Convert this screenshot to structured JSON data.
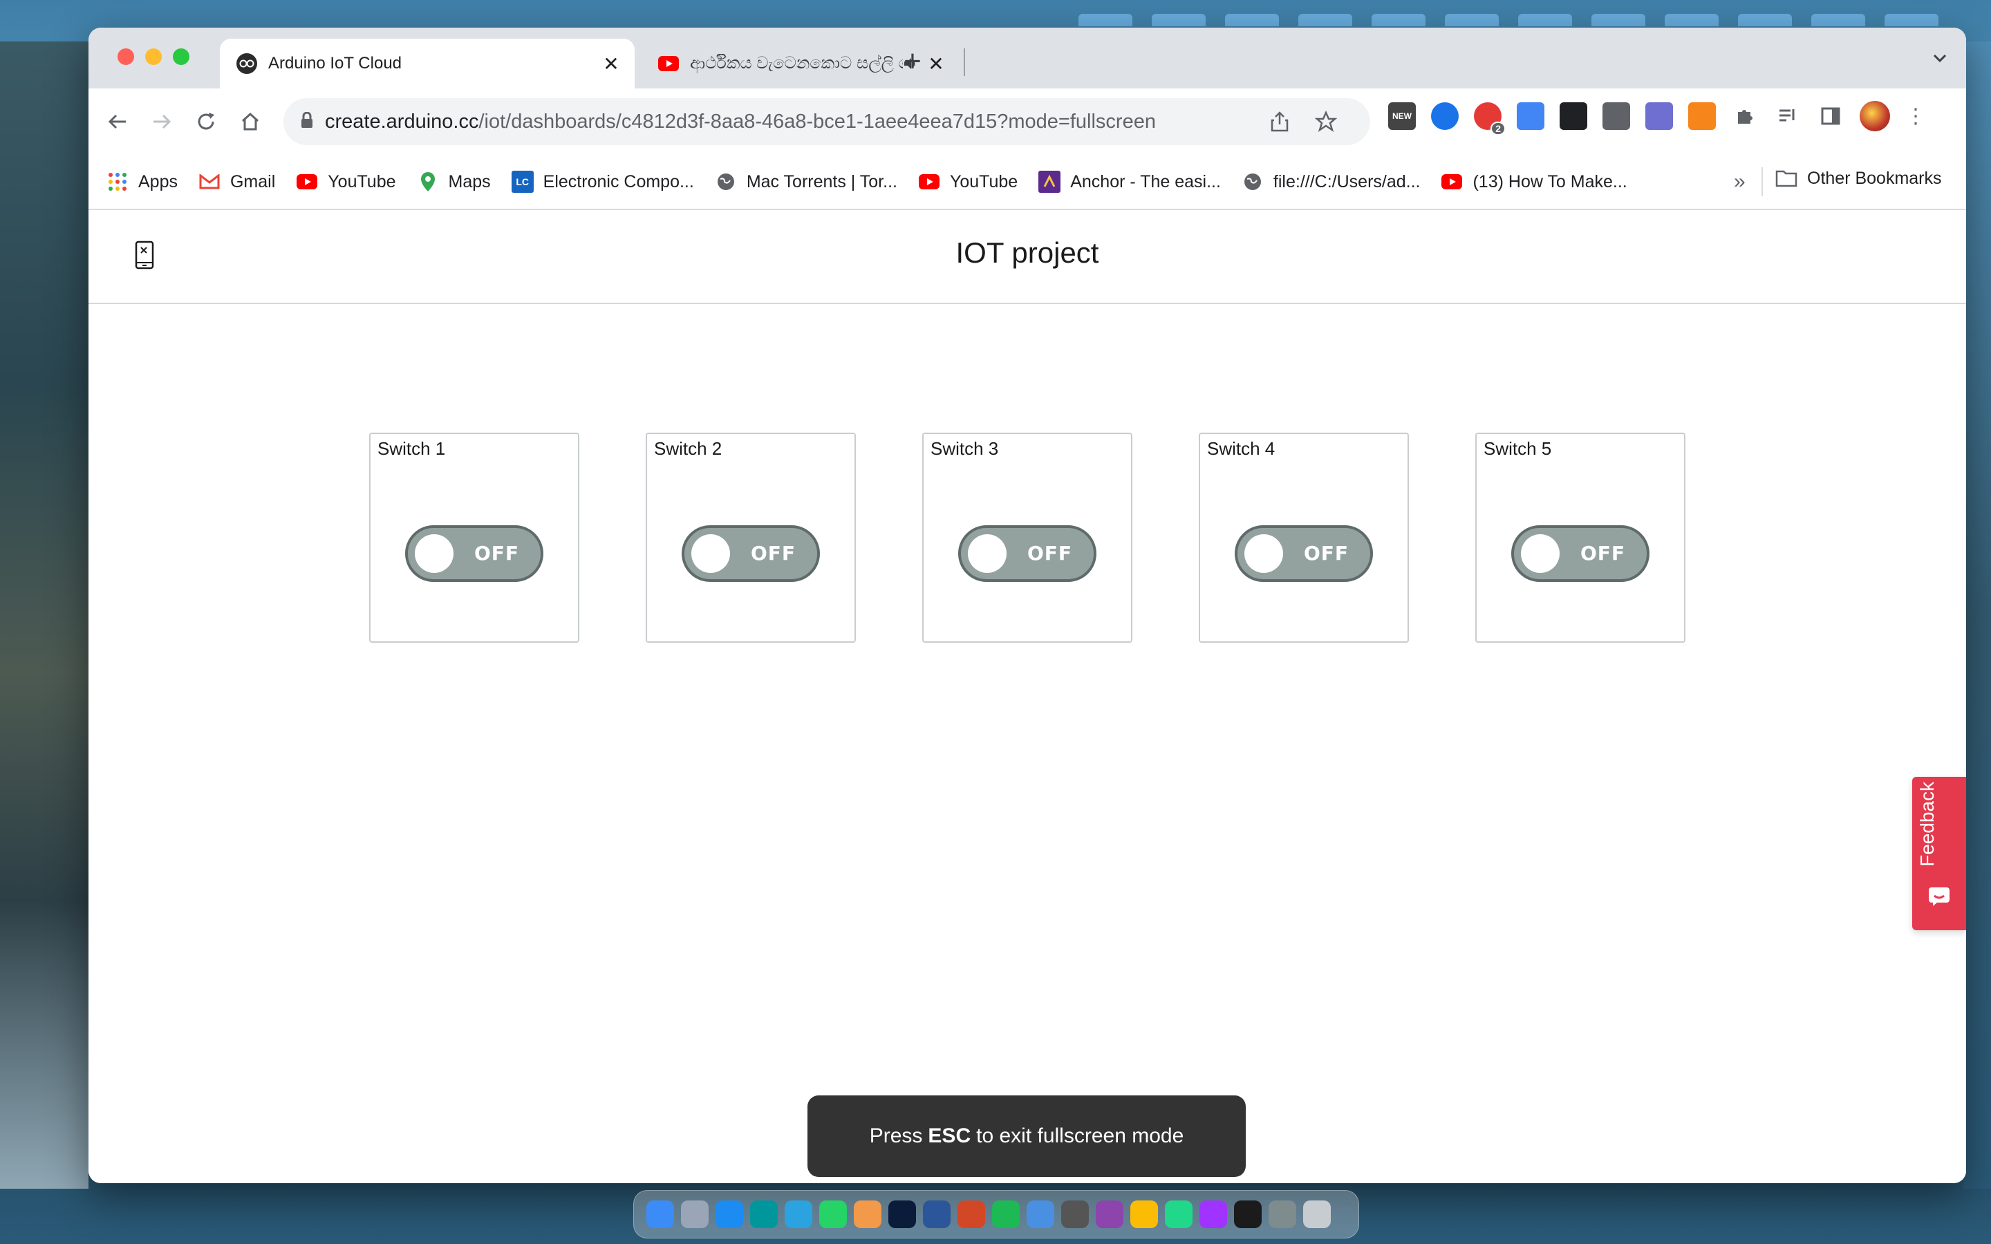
{
  "browser": {
    "tabs": [
      {
        "title": "Arduino IoT Cloud",
        "favicon": "arduino-icon",
        "active": true
      },
      {
        "title": "ආර්ථිකය වැටෙනකොට සල්ලි කො",
        "favicon": "youtube-icon",
        "active": false,
        "audio": true
      }
    ],
    "new_tab_label": "+",
    "url_host": "create.arduino.cc",
    "url_path": "/iot/dashboards/c4812d3f-8aa8-46a8-bce1-1aee4eea7d15?mode=fullscreen",
    "extension_badge": "2",
    "extension_new_label": "NEW"
  },
  "bookmarks": {
    "items": [
      {
        "label": "Apps",
        "icon": "apps-grid-icon"
      },
      {
        "label": "Gmail",
        "icon": "gmail-icon"
      },
      {
        "label": "YouTube",
        "icon": "youtube-icon"
      },
      {
        "label": "Maps",
        "icon": "maps-pin-icon"
      },
      {
        "label": "Electronic Compo...",
        "icon": "lc-icon",
        "icon_text": "LC"
      },
      {
        "label": "Mac Torrents | Tor...",
        "icon": "globe-icon"
      },
      {
        "label": "YouTube",
        "icon": "youtube-icon"
      },
      {
        "label": "Anchor - The easi...",
        "icon": "anchor-icon"
      },
      {
        "label": "file:///C:/Users/ad...",
        "icon": "globe-icon"
      },
      {
        "label": "(13) How To Make...",
        "icon": "youtube-icon"
      }
    ],
    "overflow": "»",
    "other": "Other Bookmarks"
  },
  "dashboard": {
    "title": "IOT project",
    "switches": [
      {
        "label": "Switch 1",
        "state": "OFF"
      },
      {
        "label": "Switch 2",
        "state": "OFF"
      },
      {
        "label": "Switch 3",
        "state": "OFF"
      },
      {
        "label": "Switch 4",
        "state": "OFF"
      },
      {
        "label": "Switch 5",
        "state": "OFF"
      }
    ],
    "feedback_label": "Feedback"
  },
  "toast": {
    "prefix": "Press",
    "key": "ESC",
    "suffix": "to exit fullscreen mode"
  },
  "colors": {
    "toggle_off": "#94a29f",
    "feedback": "#e5394d",
    "toast_bg": "#333333"
  }
}
